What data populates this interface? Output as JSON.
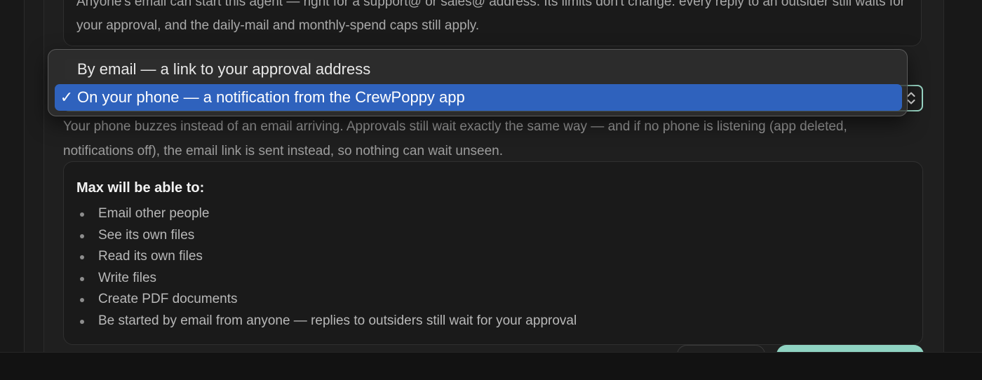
{
  "note": {
    "text": "Anyone's email can start this agent — right for a support@ or sales@ address. Its limits don't change: every reply to an outsider still waits for your approval, and the daily-mail and monthly-spend caps still apply."
  },
  "approval_select": {
    "options": [
      {
        "label": "By email — a link to your approval address",
        "selected": false
      },
      {
        "label": "On your phone — a notification from the CrewPoppy app",
        "selected": true
      }
    ],
    "checkmark": "✓"
  },
  "helper": {
    "text": "Your phone buzzes instead of an email arriving. Approvals still wait exactly the same way — and if no phone is listening (app deleted, notifications off), the email link is sent instead, so nothing can wait unseen."
  },
  "permissions": {
    "title": "Max will be able to:",
    "items": [
      "Email other people",
      "See its own files",
      "Read its own files",
      "Write files",
      "Create PDF documents",
      "Be started by email from anyone — replies to outsiders still wait for your approval"
    ]
  },
  "colors": {
    "accent": "#9ad8c6",
    "menu_highlight": "#2f62bd",
    "background": "#1f1f1f"
  }
}
